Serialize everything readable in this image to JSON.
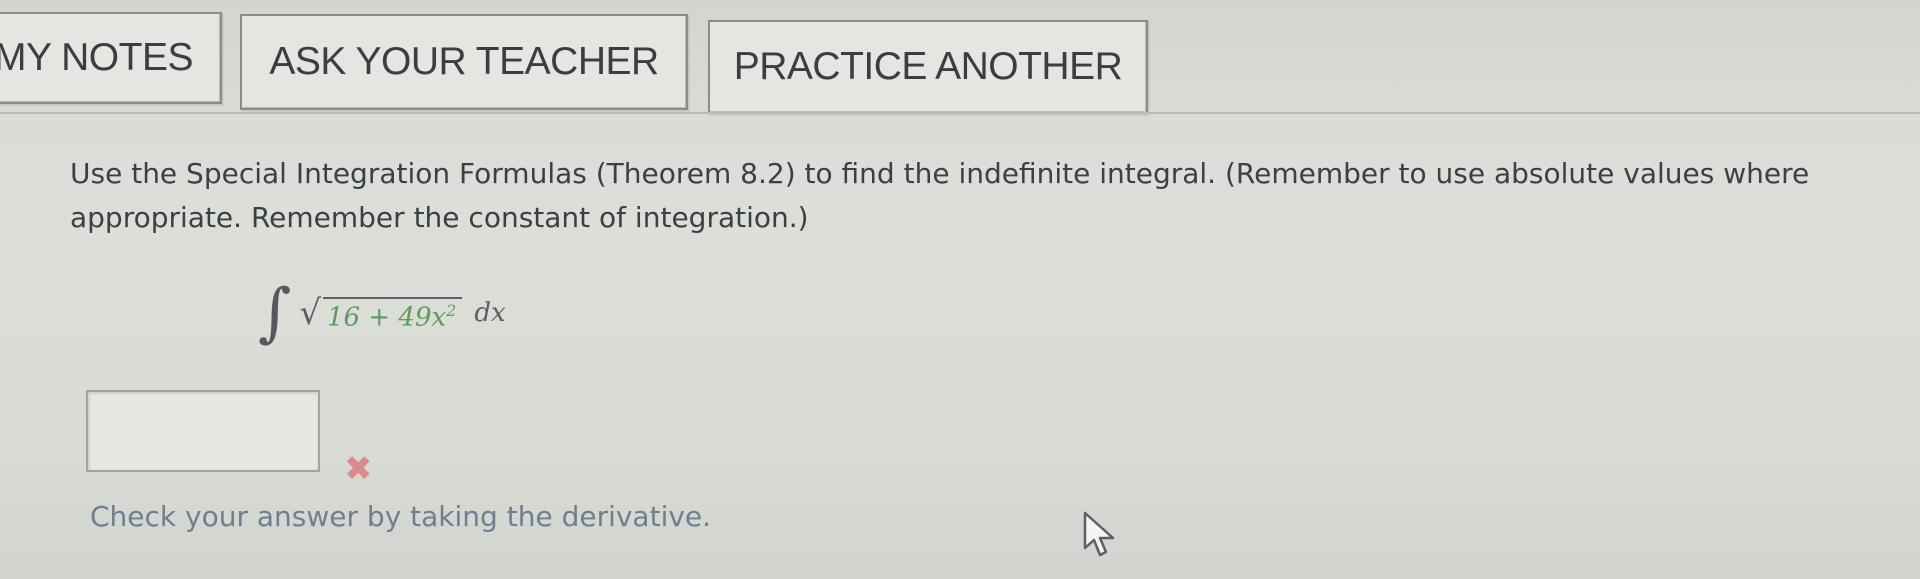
{
  "toolbar": {
    "my_notes_label": "MY NOTES",
    "ask_teacher_label": "ASK YOUR TEACHER",
    "practice_another_label": "PRACTICE ANOTHER"
  },
  "question": {
    "prompt": "Use the Special Integration Formulas (Theorem 8.2) to find the indefinite integral. (Remember to use absolute values where appropriate. Remember the constant of integration.)",
    "integral_symbol": "∫",
    "radical_symbol": "√",
    "radicand": "16 + 49x",
    "exponent": "2",
    "differential": "dx"
  },
  "answer": {
    "value": "",
    "status_mark": "✖",
    "status": "incorrect"
  },
  "hint": {
    "text": "Check your answer by taking the derivative."
  },
  "colors": {
    "background": "#d9dbd6",
    "text": "#3b4046",
    "radicand_green": "#5f9a5f",
    "incorrect_red": "#d98a8a",
    "hint_blue_gray": "#6f7f8f"
  },
  "icons": {
    "status_icon": "x-mark-icon",
    "pointer_icon": "mouse-cursor-icon"
  }
}
